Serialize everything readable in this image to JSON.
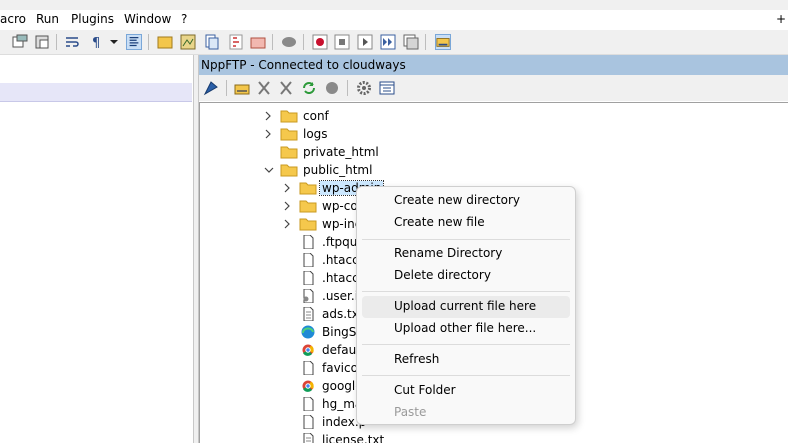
{
  "menubar": {
    "items": [
      "acro",
      "Run",
      "Plugins",
      "Window",
      "?"
    ],
    "plus": "+"
  },
  "ftp_panel": {
    "title": "NppFTP - Connected to cloudways",
    "tree": [
      {
        "label": "conf",
        "type": "folder",
        "expand": "collapsed"
      },
      {
        "label": "logs",
        "type": "folder",
        "expand": "collapsed"
      },
      {
        "label": "private_html",
        "type": "folder",
        "expand": "none"
      },
      {
        "label": "public_html",
        "type": "folder",
        "expand": "expanded"
      },
      {
        "label": "wp-admin",
        "type": "folder",
        "expand": "collapsed",
        "selected": true
      },
      {
        "label": "wp-co",
        "type": "folder",
        "expand": "collapsed"
      },
      {
        "label": "wp-inc",
        "type": "folder",
        "expand": "collapsed"
      },
      {
        "label": ".ftpquo",
        "type": "file"
      },
      {
        "label": ".htacce",
        "type": "file"
      },
      {
        "label": ".htacce",
        "type": "file"
      },
      {
        "label": ".user.in",
        "type": "file-gear"
      },
      {
        "label": "ads.txt",
        "type": "file-text"
      },
      {
        "label": "BingSit",
        "type": "edge"
      },
      {
        "label": "default",
        "type": "chrome"
      },
      {
        "label": "favicor",
        "type": "file"
      },
      {
        "label": "google",
        "type": "chrome"
      },
      {
        "label": "hg_ma",
        "type": "file"
      },
      {
        "label": "index.p",
        "type": "file"
      },
      {
        "label": "license.txt",
        "type": "file-text"
      }
    ]
  },
  "context_menu": {
    "items": [
      {
        "label": "Create new directory",
        "enabled": true
      },
      {
        "label": "Create new file",
        "enabled": true
      },
      {
        "label": "Rename Directory",
        "enabled": true
      },
      {
        "label": "Delete directory",
        "enabled": true
      },
      {
        "label": "Upload current file here",
        "enabled": true,
        "hovered": true
      },
      {
        "label": "Upload other file here...",
        "enabled": true
      },
      {
        "label": "Refresh",
        "enabled": true
      },
      {
        "label": "Cut Folder",
        "enabled": true
      },
      {
        "label": "Paste",
        "enabled": false
      }
    ]
  },
  "toolbar_icons": [
    "cut-icon",
    "paste-icon",
    "wrap-icon",
    "pilcrow-icon",
    "dropdown-icon",
    "indent-guide-icon",
    "folder-icon",
    "map-icon",
    "doc-map-icon",
    "function-list-icon",
    "folder-as-workspace-icon",
    "comment-icon",
    "record-icon",
    "stop-icon",
    "play-icon",
    "run-multiple-icon",
    "save-macro-icon",
    "ftp-icon"
  ],
  "ftp_toolbar_icons": [
    "connect-icon",
    "open-dir-icon",
    "download-icon",
    "upload-icon",
    "refresh-icon",
    "abort-icon",
    "settings-icon",
    "message-window-icon"
  ],
  "colors": {
    "folder": "#f5c84c",
    "header": "#a9c4df",
    "selection": "#cce8ff"
  }
}
